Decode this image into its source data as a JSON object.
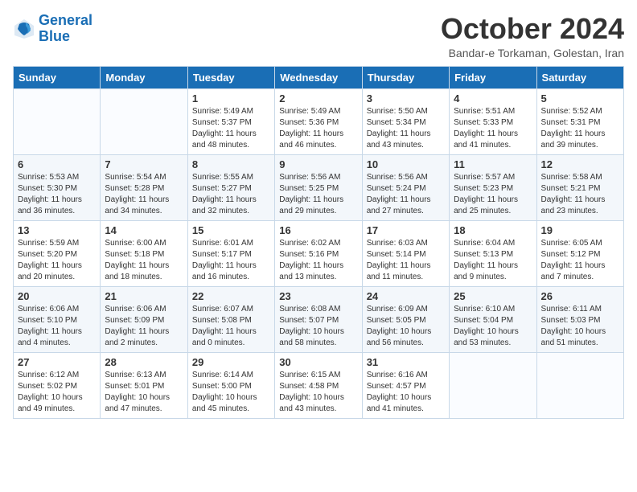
{
  "header": {
    "logo_line1": "General",
    "logo_line2": "Blue",
    "month_title": "October 2024",
    "subtitle": "Bandar-e Torkaman, Golestan, Iran"
  },
  "days_of_week": [
    "Sunday",
    "Monday",
    "Tuesday",
    "Wednesday",
    "Thursday",
    "Friday",
    "Saturday"
  ],
  "weeks": [
    [
      {
        "day": "",
        "detail": ""
      },
      {
        "day": "",
        "detail": ""
      },
      {
        "day": "1",
        "detail": "Sunrise: 5:49 AM\nSunset: 5:37 PM\nDaylight: 11 hours\nand 48 minutes."
      },
      {
        "day": "2",
        "detail": "Sunrise: 5:49 AM\nSunset: 5:36 PM\nDaylight: 11 hours\nand 46 minutes."
      },
      {
        "day": "3",
        "detail": "Sunrise: 5:50 AM\nSunset: 5:34 PM\nDaylight: 11 hours\nand 43 minutes."
      },
      {
        "day": "4",
        "detail": "Sunrise: 5:51 AM\nSunset: 5:33 PM\nDaylight: 11 hours\nand 41 minutes."
      },
      {
        "day": "5",
        "detail": "Sunrise: 5:52 AM\nSunset: 5:31 PM\nDaylight: 11 hours\nand 39 minutes."
      }
    ],
    [
      {
        "day": "6",
        "detail": "Sunrise: 5:53 AM\nSunset: 5:30 PM\nDaylight: 11 hours\nand 36 minutes."
      },
      {
        "day": "7",
        "detail": "Sunrise: 5:54 AM\nSunset: 5:28 PM\nDaylight: 11 hours\nand 34 minutes."
      },
      {
        "day": "8",
        "detail": "Sunrise: 5:55 AM\nSunset: 5:27 PM\nDaylight: 11 hours\nand 32 minutes."
      },
      {
        "day": "9",
        "detail": "Sunrise: 5:56 AM\nSunset: 5:25 PM\nDaylight: 11 hours\nand 29 minutes."
      },
      {
        "day": "10",
        "detail": "Sunrise: 5:56 AM\nSunset: 5:24 PM\nDaylight: 11 hours\nand 27 minutes."
      },
      {
        "day": "11",
        "detail": "Sunrise: 5:57 AM\nSunset: 5:23 PM\nDaylight: 11 hours\nand 25 minutes."
      },
      {
        "day": "12",
        "detail": "Sunrise: 5:58 AM\nSunset: 5:21 PM\nDaylight: 11 hours\nand 23 minutes."
      }
    ],
    [
      {
        "day": "13",
        "detail": "Sunrise: 5:59 AM\nSunset: 5:20 PM\nDaylight: 11 hours\nand 20 minutes."
      },
      {
        "day": "14",
        "detail": "Sunrise: 6:00 AM\nSunset: 5:18 PM\nDaylight: 11 hours\nand 18 minutes."
      },
      {
        "day": "15",
        "detail": "Sunrise: 6:01 AM\nSunset: 5:17 PM\nDaylight: 11 hours\nand 16 minutes."
      },
      {
        "day": "16",
        "detail": "Sunrise: 6:02 AM\nSunset: 5:16 PM\nDaylight: 11 hours\nand 13 minutes."
      },
      {
        "day": "17",
        "detail": "Sunrise: 6:03 AM\nSunset: 5:14 PM\nDaylight: 11 hours\nand 11 minutes."
      },
      {
        "day": "18",
        "detail": "Sunrise: 6:04 AM\nSunset: 5:13 PM\nDaylight: 11 hours\nand 9 minutes."
      },
      {
        "day": "19",
        "detail": "Sunrise: 6:05 AM\nSunset: 5:12 PM\nDaylight: 11 hours\nand 7 minutes."
      }
    ],
    [
      {
        "day": "20",
        "detail": "Sunrise: 6:06 AM\nSunset: 5:10 PM\nDaylight: 11 hours\nand 4 minutes."
      },
      {
        "day": "21",
        "detail": "Sunrise: 6:06 AM\nSunset: 5:09 PM\nDaylight: 11 hours\nand 2 minutes."
      },
      {
        "day": "22",
        "detail": "Sunrise: 6:07 AM\nSunset: 5:08 PM\nDaylight: 11 hours\nand 0 minutes."
      },
      {
        "day": "23",
        "detail": "Sunrise: 6:08 AM\nSunset: 5:07 PM\nDaylight: 10 hours\nand 58 minutes."
      },
      {
        "day": "24",
        "detail": "Sunrise: 6:09 AM\nSunset: 5:05 PM\nDaylight: 10 hours\nand 56 minutes."
      },
      {
        "day": "25",
        "detail": "Sunrise: 6:10 AM\nSunset: 5:04 PM\nDaylight: 10 hours\nand 53 minutes."
      },
      {
        "day": "26",
        "detail": "Sunrise: 6:11 AM\nSunset: 5:03 PM\nDaylight: 10 hours\nand 51 minutes."
      }
    ],
    [
      {
        "day": "27",
        "detail": "Sunrise: 6:12 AM\nSunset: 5:02 PM\nDaylight: 10 hours\nand 49 minutes."
      },
      {
        "day": "28",
        "detail": "Sunrise: 6:13 AM\nSunset: 5:01 PM\nDaylight: 10 hours\nand 47 minutes."
      },
      {
        "day": "29",
        "detail": "Sunrise: 6:14 AM\nSunset: 5:00 PM\nDaylight: 10 hours\nand 45 minutes."
      },
      {
        "day": "30",
        "detail": "Sunrise: 6:15 AM\nSunset: 4:58 PM\nDaylight: 10 hours\nand 43 minutes."
      },
      {
        "day": "31",
        "detail": "Sunrise: 6:16 AM\nSunset: 4:57 PM\nDaylight: 10 hours\nand 41 minutes."
      },
      {
        "day": "",
        "detail": ""
      },
      {
        "day": "",
        "detail": ""
      }
    ]
  ]
}
